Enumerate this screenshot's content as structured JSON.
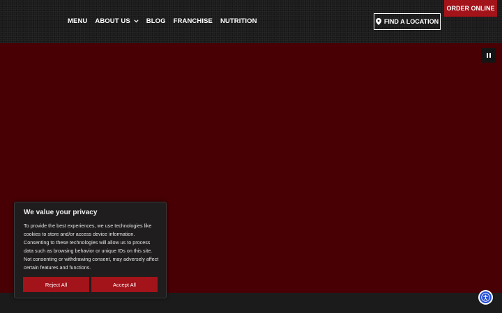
{
  "header": {
    "nav": [
      {
        "label": "MENU"
      },
      {
        "label": "ABOUT US"
      },
      {
        "label": "BLOG"
      },
      {
        "label": "FRANCHISE"
      },
      {
        "label": "NUTRITION"
      }
    ],
    "find_location_label": "FIND A LOCATION",
    "order_online_label": "ORDER ONLINE"
  },
  "hero": {
    "pause_icon": "pause-icon"
  },
  "cookie_banner": {
    "title": "We value your privacy",
    "text": "To provide the best experiences, we use technologies like cookies to store and/or access device information. Consenting to these technologies will allow us to process data such as browsing behavior or unique IDs on this site. Not consenting or withdrawing consent, may adversely affect certain features and functions.",
    "reject_label": "Reject All",
    "accept_label": "Accept All"
  },
  "accessibility": {
    "icon": "accessibility-icon"
  },
  "colors": {
    "brand_red": "#a3131a",
    "hero_bg": "#480004",
    "header_bg": "#1b1b1b",
    "accessibility_blue": "#2750d6"
  }
}
